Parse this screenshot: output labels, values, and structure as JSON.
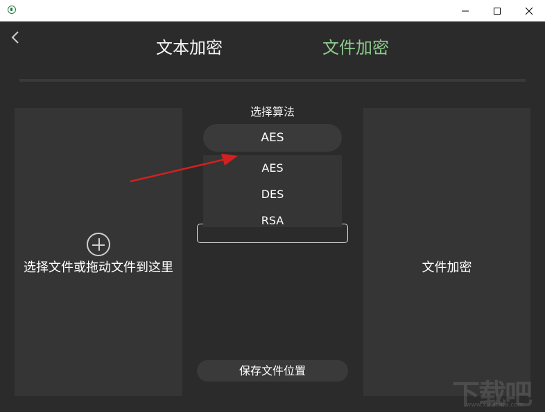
{
  "window": {
    "icons": {
      "app": "app-icon",
      "minimize": "minimize-icon",
      "maximize": "maximize-icon",
      "close": "close-icon"
    }
  },
  "nav": {
    "back_icon": "chevron-left-icon",
    "tabs": [
      {
        "label": "文本加密",
        "active": false
      },
      {
        "label": "文件加密",
        "active": true
      }
    ]
  },
  "colors": {
    "accent": "#8fcb8f",
    "background": "#2b2b2b",
    "panel": "#353535",
    "arrow": "#d42020"
  },
  "left_panel": {
    "icon": "plus-circle-icon",
    "label": "选择文件或拖动文件到这里"
  },
  "algorithm": {
    "label": "选择算法",
    "selected": "AES",
    "options": [
      "AES",
      "DES",
      "RSA"
    ]
  },
  "save_button": {
    "label": "保存文件位置"
  },
  "right_panel": {
    "label": "文件加密"
  },
  "watermark": {
    "text": "下载吧",
    "sub": "www.xiazaiba.com"
  }
}
